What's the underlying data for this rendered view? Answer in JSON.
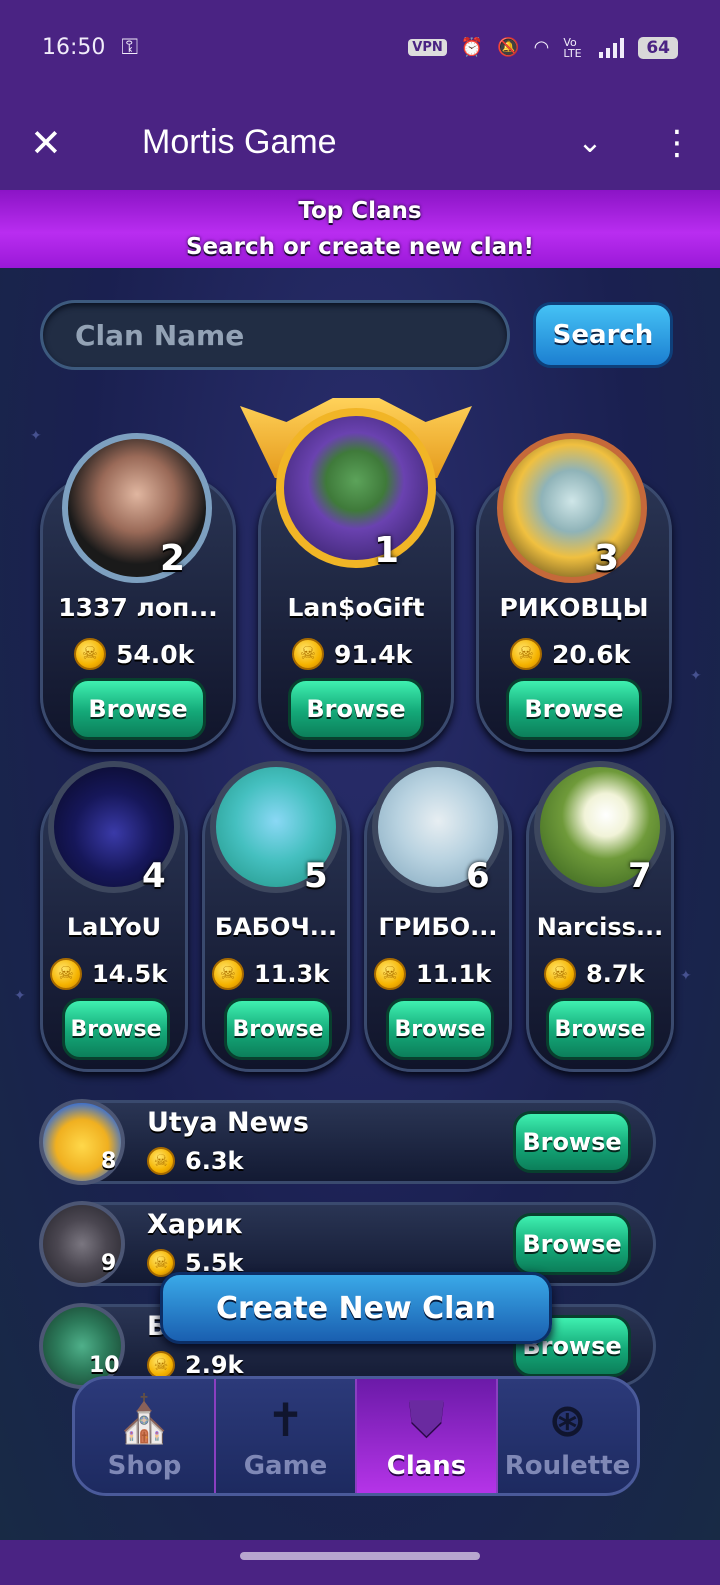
{
  "status": {
    "time": "16:50",
    "vpn": "VPN",
    "lte": "Vo LTE",
    "battery": "64"
  },
  "appbar": {
    "title": "Mortis Game"
  },
  "banner": {
    "line1": "Top Clans",
    "line2": "Search or create new clan!"
  },
  "search": {
    "placeholder": "Clan Name",
    "button": "Search"
  },
  "top": [
    {
      "rank": "2",
      "name": "1337 лоп...",
      "coins": "54.0k",
      "browse": "Browse"
    },
    {
      "rank": "1",
      "name": "Lan$oGift",
      "coins": "91.4k",
      "browse": "Browse"
    },
    {
      "rank": "3",
      "name": "РИКОВЦЫ",
      "coins": "20.6k",
      "browse": "Browse"
    },
    {
      "rank": "4",
      "name": "LaLYoU",
      "coins": "14.5k",
      "browse": "Browse"
    },
    {
      "rank": "5",
      "name": "БАБОЧ...",
      "coins": "11.3k",
      "browse": "Browse"
    },
    {
      "rank": "6",
      "name": "ГРИБО...",
      "coins": "11.1k",
      "browse": "Browse"
    },
    {
      "rank": "7",
      "name": "Narciss...",
      "coins": "8.7k",
      "browse": "Browse"
    }
  ],
  "list": [
    {
      "rank": "8",
      "name": "Utya News",
      "coins": "6.3k",
      "browse": "Browse"
    },
    {
      "rank": "9",
      "name": "Харик",
      "coins": "5.5k",
      "browse": "Browse"
    },
    {
      "rank": "10",
      "name": "Б",
      "coins": "2.9k",
      "browse": "Browse"
    }
  ],
  "create_button": "Create New Clan",
  "nav": [
    {
      "label": "Shop",
      "icon": "shop-icon"
    },
    {
      "label": "Game",
      "icon": "grave-icon"
    },
    {
      "label": "Clans",
      "icon": "clan-emblem-icon"
    },
    {
      "label": "Roulette",
      "icon": "roulette-icon"
    }
  ],
  "colors": {
    "header": "#4a2383",
    "accent_purple": "#b92df0",
    "browse_green": "#14a878",
    "search_blue": "#1c7fd1"
  }
}
